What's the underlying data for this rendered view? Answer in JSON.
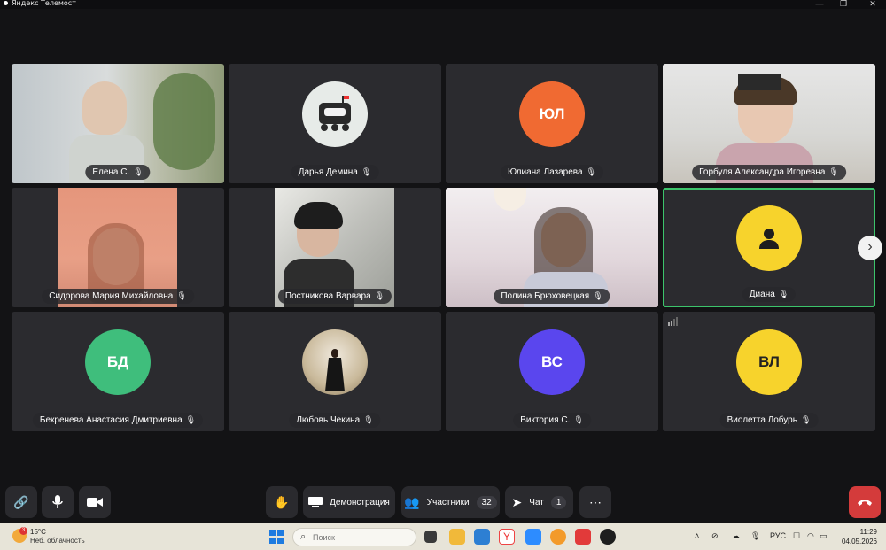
{
  "window": {
    "title": "Яндекс Телемост",
    "controls": [
      "—",
      "❐",
      "✕"
    ]
  },
  "participants": [
    {
      "name": "Елена С.",
      "type": "video",
      "bg": "#c9ced0"
    },
    {
      "name": "Дарья Демина",
      "type": "avatar-image",
      "bg": "#2b2b2f"
    },
    {
      "name": "Юлиана Лазарева",
      "type": "avatar",
      "initials": "ЮЛ",
      "color": "#f06a32"
    },
    {
      "name": "Горбуля Александра Игоревна",
      "type": "video",
      "bg": "#dcdcdc"
    },
    {
      "name": "Сидорова Мария Михайловна",
      "type": "video",
      "bg": "#e08f75"
    },
    {
      "name": "Постникова Варвара",
      "type": "video",
      "bg": "#c4c4c0"
    },
    {
      "name": "Полина Брюховецкая",
      "type": "video",
      "bg": "#d8d0d5"
    },
    {
      "name": "Диана",
      "type": "avatar-icon",
      "color": "#f7d32c",
      "active": true
    },
    {
      "name": "Бекренева Анастасия Дмитриевна",
      "type": "avatar",
      "initials": "БД",
      "color": "#3fbe7c"
    },
    {
      "name": "Любовь Чекина",
      "type": "avatar-image",
      "bg": "#2b2b2f"
    },
    {
      "name": "Виктория С.",
      "type": "avatar",
      "initials": "ВС",
      "color": "#5a46ee"
    },
    {
      "name": "Виолетта Лобурь",
      "type": "avatar",
      "initials": "ВЛ",
      "color": "#f7d32c"
    }
  ],
  "toolbar": {
    "demo_label": "Демонстрация",
    "participants_label": "Участники",
    "participants_count": "32",
    "chat_label": "Чат",
    "chat_count": "1"
  },
  "taskbar": {
    "weather_temp": "15°C",
    "weather_cond": "Неб. облачность",
    "weather_badge": "3",
    "search_placeholder": "Поиск",
    "lang": "РУС",
    "time": "11:29",
    "date": "04.05.2026"
  }
}
